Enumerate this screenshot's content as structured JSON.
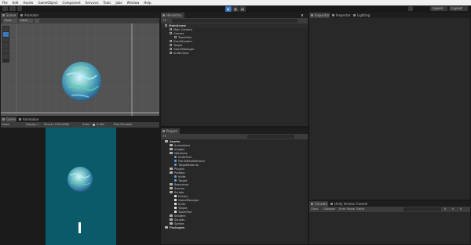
{
  "menu": [
    "File",
    "Edit",
    "Assets",
    "GameObject",
    "Component",
    "Services",
    "Tools",
    "Jobs",
    "Window",
    "Help"
  ],
  "toolbar": {
    "layers_label": "Layers",
    "layout_label": "Layout"
  },
  "scene_panel": {
    "tabs": [
      "Scene",
      "Animator"
    ],
    "pivot": "Pivot",
    "local": "Local",
    "persp_label": ""
  },
  "game_panel": {
    "tabs": [
      "Game",
      "Animation"
    ],
    "display": "Game",
    "display_num": "Display 1",
    "device": "Phone (795x1080)",
    "scale_label": "Scale",
    "scale_value": "0.38x",
    "play_focused": "Play Focused"
  },
  "hierarchy": {
    "tab": "Hierarchy",
    "items": [
      {
        "label": "MainScene",
        "depth": 0,
        "kind": "scene"
      },
      {
        "label": "Main Camera",
        "depth": 1,
        "kind": "go"
      },
      {
        "label": "Canvas",
        "depth": 1,
        "kind": "go"
      },
      {
        "label": "TouchPad",
        "depth": 2,
        "kind": "go"
      },
      {
        "label": "EventSystem",
        "depth": 1,
        "kind": "go"
      },
      {
        "label": "Target",
        "depth": 1,
        "kind": "go"
      },
      {
        "label": "GameManager",
        "depth": 1,
        "kind": "go"
      },
      {
        "label": "KnifeClone",
        "depth": 1,
        "kind": "go"
      }
    ]
  },
  "project": {
    "tab": "Project",
    "items": [
      {
        "label": "Assets",
        "depth": 0,
        "kind": "folder"
      },
      {
        "label": "Animations",
        "depth": 1,
        "kind": "folder"
      },
      {
        "label": "Images",
        "depth": 1,
        "kind": "folder"
      },
      {
        "label": "Materials",
        "depth": 1,
        "kind": "folder"
      },
      {
        "label": "KnifeTrail",
        "depth": 2,
        "kind": "mat"
      },
      {
        "label": "PointMetalMaterial",
        "depth": 2,
        "kind": "mat"
      },
      {
        "label": "TargetMaterial",
        "depth": 2,
        "kind": "mat"
      },
      {
        "label": "Plugins",
        "depth": 1,
        "kind": "folder"
      },
      {
        "label": "Prefabs",
        "depth": 1,
        "kind": "folder"
      },
      {
        "label": "Knife",
        "depth": 2,
        "kind": "mat"
      },
      {
        "label": "Target",
        "depth": 2,
        "kind": "mat"
      },
      {
        "label": "Resources",
        "depth": 1,
        "kind": "folder"
      },
      {
        "label": "Scenes",
        "depth": 1,
        "kind": "folder"
      },
      {
        "label": "Scripts",
        "depth": 1,
        "kind": "folder"
      },
      {
        "label": "Enemy",
        "depth": 2,
        "kind": "script"
      },
      {
        "label": "GameManager",
        "depth": 2,
        "kind": "script"
      },
      {
        "label": "Knife",
        "depth": 2,
        "kind": "script"
      },
      {
        "label": "Target",
        "depth": 2,
        "kind": "script"
      },
      {
        "label": "TouchPad",
        "depth": 2,
        "kind": "script"
      },
      {
        "label": "Shaders",
        "depth": 1,
        "kind": "folder"
      },
      {
        "label": "Sounds",
        "depth": 1,
        "kind": "folder"
      },
      {
        "label": "Sprites",
        "depth": 1,
        "kind": "folder"
      },
      {
        "label": "Packages",
        "depth": 0,
        "kind": "folder"
      }
    ]
  },
  "inspector": {
    "tabs": [
      "Inspector",
      "Inspector",
      "Lighting"
    ]
  },
  "console": {
    "tabs": [
      "Console",
      "Unity Version Control"
    ],
    "buttons": [
      "Clear",
      "Collapse",
      "Error Pause",
      "Editor"
    ],
    "counts": [
      "0",
      "0",
      "0"
    ]
  },
  "colors": {
    "game_bg": "#0a5a6a",
    "scene_bg": "#4b4b4b",
    "panel_bg": "#282828",
    "accent_play": "#3a79bb"
  },
  "icons": [
    "play-icon",
    "pause-icon",
    "step-icon",
    "cube-icon",
    "folder-icon",
    "script-icon"
  ]
}
